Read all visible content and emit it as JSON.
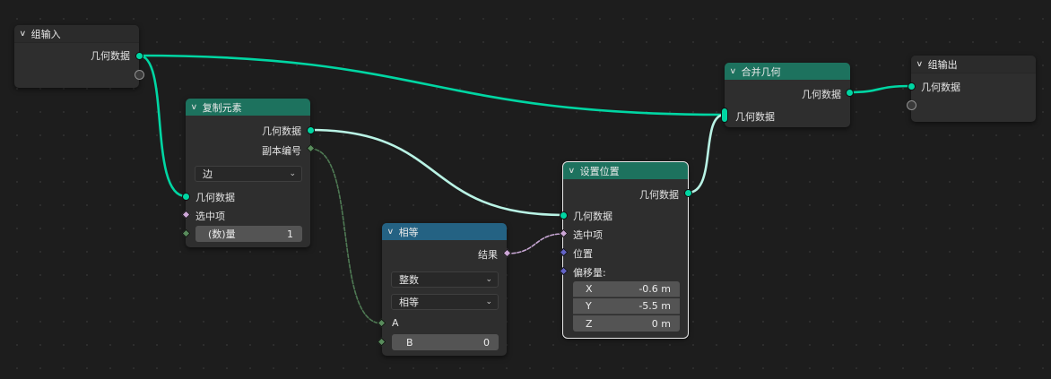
{
  "colors": {
    "geometry_socket": "#00d6a3",
    "geometry_header": "#1d725e",
    "function_header": "#246283",
    "boolean_socket": "#cca6d6",
    "integer_socket": "#598c5c",
    "vector_socket": "#6363c7"
  },
  "group_input": {
    "title": "组输入",
    "geometry": "几何数据"
  },
  "duplicate": {
    "title": "复制元素",
    "out_geometry": "几何数据",
    "out_index": "副本编号",
    "domain": "边",
    "in_geometry": "几何数据",
    "selection": "选中项",
    "amount_label": "(数)量",
    "amount_value": "1"
  },
  "compare": {
    "title": "相等",
    "result": "结果",
    "data_type": "整数",
    "operation": "相等",
    "a_label": "A",
    "b_label": "B",
    "b_value": "0"
  },
  "set_position": {
    "title": "设置位置",
    "out_geometry": "几何数据",
    "in_geometry": "几何数据",
    "selection": "选中项",
    "position": "位置",
    "offset": "偏移量:",
    "x_label": "X",
    "x_value": "-0.6 m",
    "y_label": "Y",
    "y_value": "-5.5 m",
    "z_label": "Z",
    "z_value": "0 m"
  },
  "join": {
    "title": "合并几何",
    "out_geometry": "几何数据",
    "in_geometry": "几何数据"
  },
  "group_output": {
    "title": "组输出",
    "geometry": "几何数据"
  }
}
